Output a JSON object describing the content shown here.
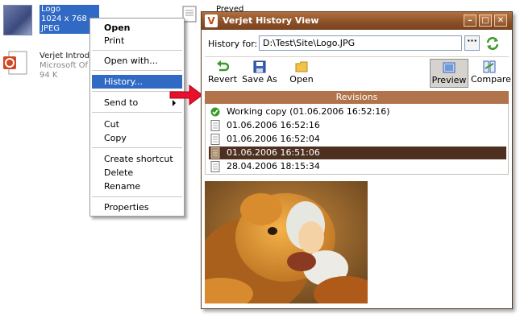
{
  "desktop": {
    "logo_file": {
      "name": "Logo",
      "dims": "1024 x 768",
      "type": "JPEG"
    },
    "ppt_file": {
      "name": "Verjet Introd",
      "app": "Microsoft Of",
      "size": "94 K"
    },
    "note_file": {
      "name": "Preved"
    }
  },
  "context_menu": {
    "items": [
      {
        "label": "Open"
      },
      {
        "label": "Print"
      },
      {
        "label": "Open with..."
      },
      {
        "label": "History..."
      },
      {
        "label": "Send to"
      },
      {
        "label": "Cut"
      },
      {
        "label": "Copy"
      },
      {
        "label": "Create shortcut"
      },
      {
        "label": "Delete"
      },
      {
        "label": "Rename"
      },
      {
        "label": "Properties"
      }
    ]
  },
  "window": {
    "title": "Verjet History View",
    "history_for_label": "History for:",
    "path": "D:\\Test\\Site\\Logo.JPG",
    "browse_label": "···",
    "toolbar": {
      "revert": "Revert",
      "save_as": "Save As",
      "open": "Open",
      "preview": "Preview",
      "compare": "Compare"
    },
    "revisions_header": "Revisions",
    "revisions": [
      {
        "label": "Working copy (01.06.2006 16:52:16)"
      },
      {
        "label": "01.06.2006 16:52:16"
      },
      {
        "label": "01.06.2006 16:52:04"
      },
      {
        "label": "01.06.2006 16:51:06"
      },
      {
        "label": "28.04.2006 18:15:34"
      }
    ]
  },
  "colors": {
    "titlebar": "#8a4e27",
    "revisions_header": "#b1744a",
    "selected_row": "#4e3020",
    "menu_highlight": "#316ac5",
    "arrow": "#e8102a"
  }
}
